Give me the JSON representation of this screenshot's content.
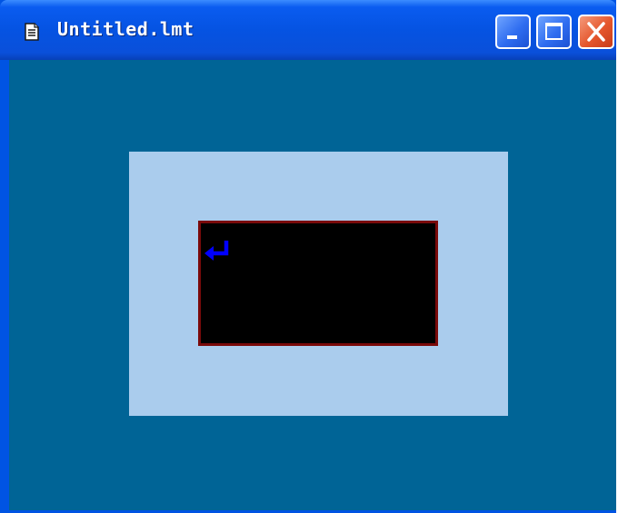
{
  "window": {
    "title": "Untitled.lmt",
    "icon": "document-icon",
    "controls": {
      "minimize_icon": "minimize-icon",
      "maximize_icon": "maximize-icon",
      "close_icon": "close-icon"
    }
  },
  "canvas": {
    "background_color": "#006496",
    "panel_color": "#aacced",
    "editor_box": {
      "background_color": "#000000",
      "border_color": "#7a0a0a",
      "cursor_icon": "return-arrow-icon",
      "cursor_color": "#0000ff"
    }
  },
  "colors": {
    "titlebar": "#0553e2",
    "close_button": "#e5562c"
  }
}
